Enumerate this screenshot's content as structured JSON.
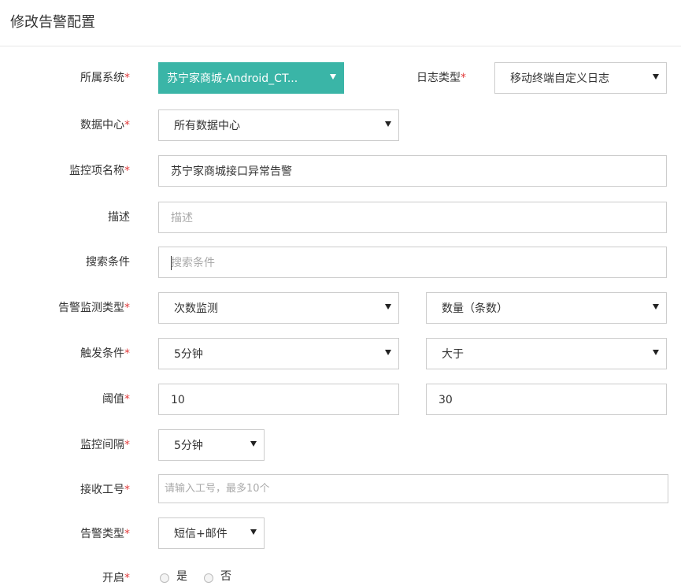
{
  "page_title": "修改告警配置",
  "form": {
    "system": {
      "label": "所属系统",
      "required": "*",
      "value": "苏宁家商城-Android_CT..."
    },
    "log_type": {
      "label": "日志类型",
      "required": "*",
      "value": "移动终端自定义日志"
    },
    "data_center": {
      "label": "数据中心",
      "required": "*",
      "value": "所有数据中心"
    },
    "monitor_name": {
      "label": "监控项名称",
      "required": "*",
      "value": "苏宁家商城接口异常告警"
    },
    "description": {
      "label": "描述",
      "placeholder": "描述"
    },
    "search_condition": {
      "label": "搜索条件",
      "placeholder": "搜索条件"
    },
    "detect_type": {
      "label": "告警监测类型",
      "required": "*",
      "value": "次数监测",
      "value2": "数量（条数）"
    },
    "trigger": {
      "label": "触发条件",
      "required": "*",
      "value": "5分钟",
      "value2": "大于"
    },
    "threshold": {
      "label": "阈值",
      "required": "*",
      "value": "10",
      "value2": "30"
    },
    "interval": {
      "label": "监控间隔",
      "required": "*",
      "value": "5分钟"
    },
    "receivers": {
      "label": "接收工号",
      "required": "*",
      "placeholder": "请输入工号，最多10个"
    },
    "alarm_type": {
      "label": "告警类型",
      "required": "*",
      "value": "短信+邮件"
    },
    "enable": {
      "label": "开启",
      "required": "*",
      "option_yes": "是",
      "option_no": "否"
    }
  }
}
